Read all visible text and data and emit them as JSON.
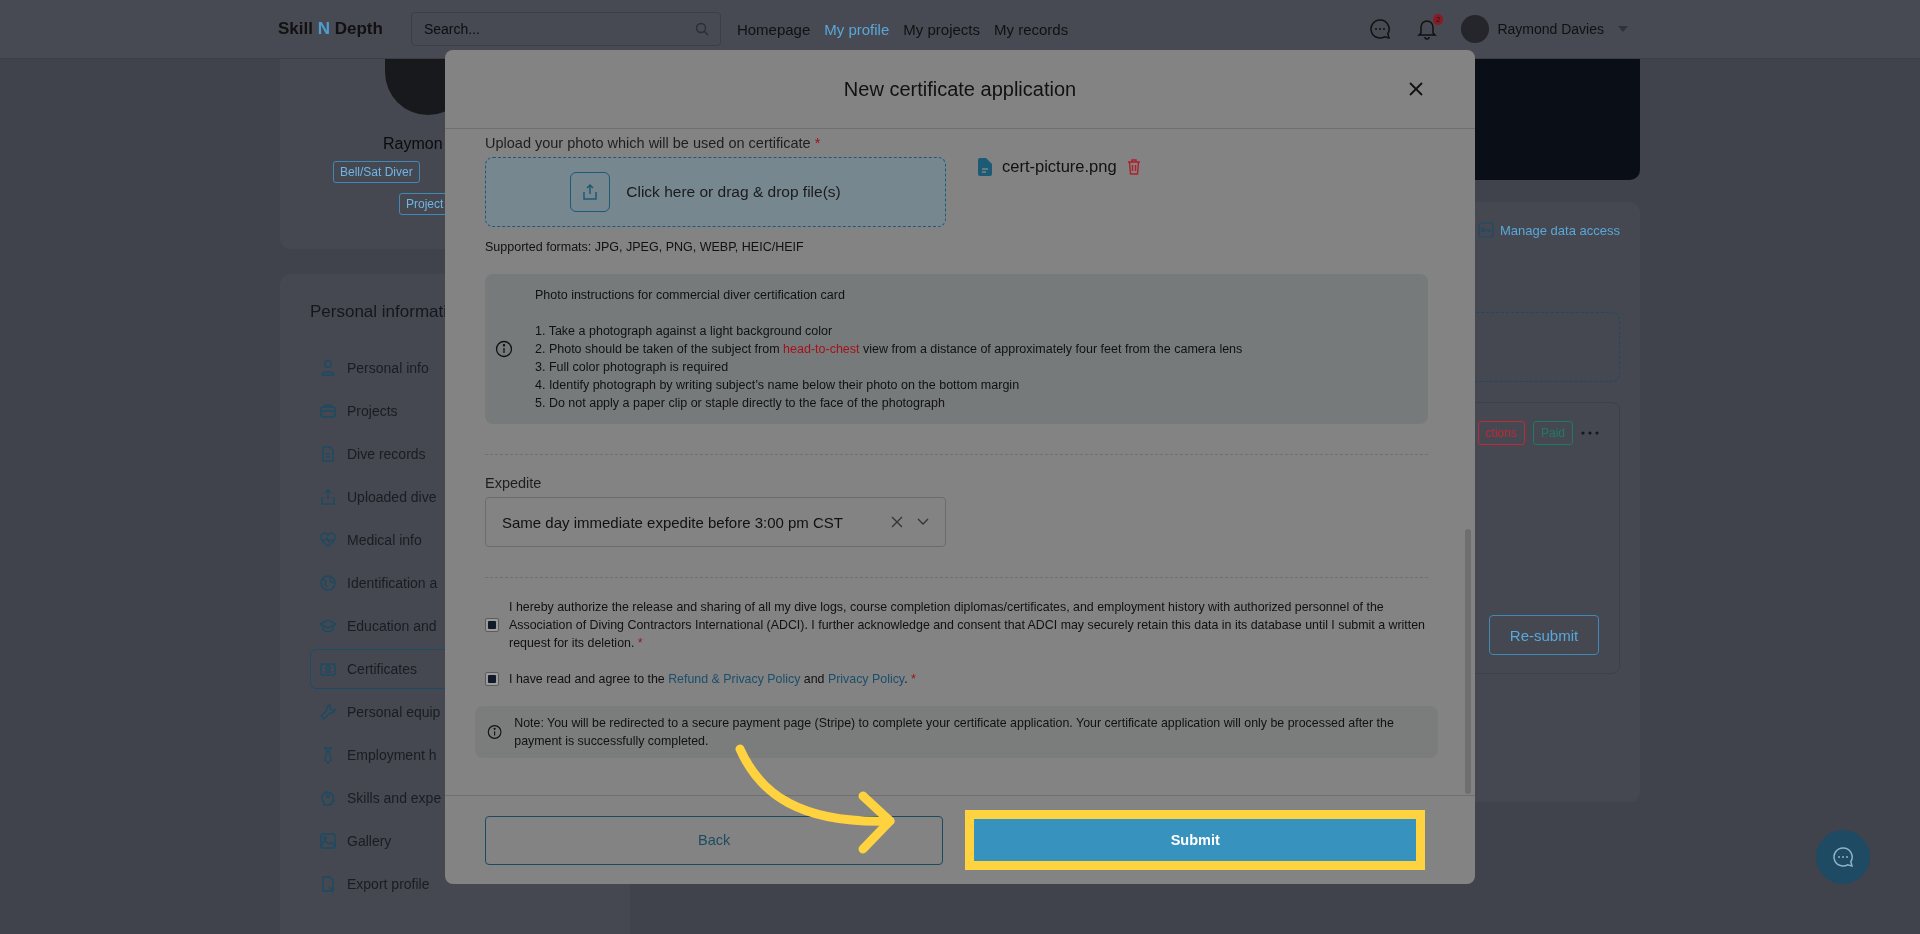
{
  "header": {
    "logo": [
      {
        "text": "Skill",
        "accent": false
      },
      {
        "text": "N",
        "accent": true
      },
      {
        "text": "Depth",
        "accent": false
      }
    ],
    "search": {
      "placeholder": "Search..."
    },
    "nav": [
      {
        "label": "Homepage",
        "selected": false
      },
      {
        "label": "My profile",
        "selected": true
      },
      {
        "label": "My projects",
        "selected": false
      },
      {
        "label": "My records",
        "selected": false
      }
    ],
    "notification_count": "2",
    "user_name": "Raymond Davies"
  },
  "profile_card": {
    "name": "Raymon",
    "tags": [
      "Bell/Sat Diver",
      "Project"
    ]
  },
  "sidebar": {
    "title": "Personal informati",
    "items": [
      {
        "label": "Personal info",
        "selected": false
      },
      {
        "label": "Projects",
        "selected": false
      },
      {
        "label": "Dive records",
        "selected": false
      },
      {
        "label": "Uploaded dive",
        "selected": false
      },
      {
        "label": "Medical info",
        "selected": false
      },
      {
        "label": "Identification a",
        "selected": false
      },
      {
        "label": "Education and",
        "selected": false
      },
      {
        "label": "Certificates",
        "selected": true
      },
      {
        "label": "Personal equip",
        "selected": false
      },
      {
        "label": "Employment h",
        "selected": false
      },
      {
        "label": "Skills and expe",
        "selected": false
      },
      {
        "label": "Gallery",
        "selected": false
      },
      {
        "label": "Export profile",
        "selected": false
      }
    ]
  },
  "right_panel": {
    "manage_link": "Manage data access",
    "tags": [
      {
        "label": "ctions",
        "color": "#c0293a"
      },
      {
        "label": "Paid",
        "color": "#1f7a64"
      }
    ],
    "resubmit": "Re-submit"
  },
  "modal": {
    "title": "New certificate application",
    "upload": {
      "label": "Upload your photo which will be used on certificate",
      "required_mark": "*",
      "dropzone": "Click here or drag & drop file(s)",
      "file_name": "cert-picture.png",
      "formats": "Supported formats: JPG, JPEG, PNG, WEBP, HEIC/HEIF"
    },
    "instructions": {
      "title": "Photo instructions for commercial diver certification card",
      "items": [
        [
          {
            "text": "1. Take a photograph against a light background color",
            "kind": "plain"
          }
        ],
        [
          {
            "text": "2. Photo should be taken of the subject from ",
            "kind": "plain"
          },
          {
            "text": "head-to-chest",
            "kind": "highlight"
          },
          {
            "text": " view from a distance of approximately four feet from the camera lens",
            "kind": "plain"
          }
        ],
        [
          {
            "text": "3. Full color photograph is required",
            "kind": "plain"
          }
        ],
        [
          {
            "text": "4. Identify photograph by writing subject’s name below their photo on the bottom margin",
            "kind": "plain"
          }
        ],
        [
          {
            "text": "5. Do not apply a paper clip or staple directly to the face of the photograph",
            "kind": "plain"
          }
        ]
      ]
    },
    "expedite": {
      "label": "Expedite",
      "value": "Same day immediate expedite before 3:00 pm CST"
    },
    "consents": [
      {
        "checked": true,
        "required_mark": "*",
        "parts": [
          {
            "text": "I hereby authorize the release and sharing of all my dive logs, course completion diplomas/certificates, and employment history with authorized personnel of the Association of Diving Contractors International (ADCI). I further acknowledge and consent that ADCI may securely retain this data in its database until I submit a written request for its deletion.",
            "kind": "plain"
          }
        ]
      },
      {
        "checked": true,
        "required_mark": "*",
        "parts": [
          {
            "text": "I have read and agree to the ",
            "kind": "plain"
          },
          {
            "text": "Refund & Privacy Policy",
            "kind": "link"
          },
          {
            "text": " and ",
            "kind": "plain"
          },
          {
            "text": "Privacy Policy",
            "kind": "link"
          },
          {
            "text": ".",
            "kind": "plain"
          }
        ]
      }
    ],
    "note": "Note: You will be redirected to a secure payment page (Stripe) to complete your certificate application. Your certificate application will only be processed after the payment is successfully completed.",
    "buttons": [
      {
        "label": "Back",
        "kind": "secondary"
      },
      {
        "label": "Submit",
        "kind": "primary",
        "highlighted": true
      }
    ]
  }
}
